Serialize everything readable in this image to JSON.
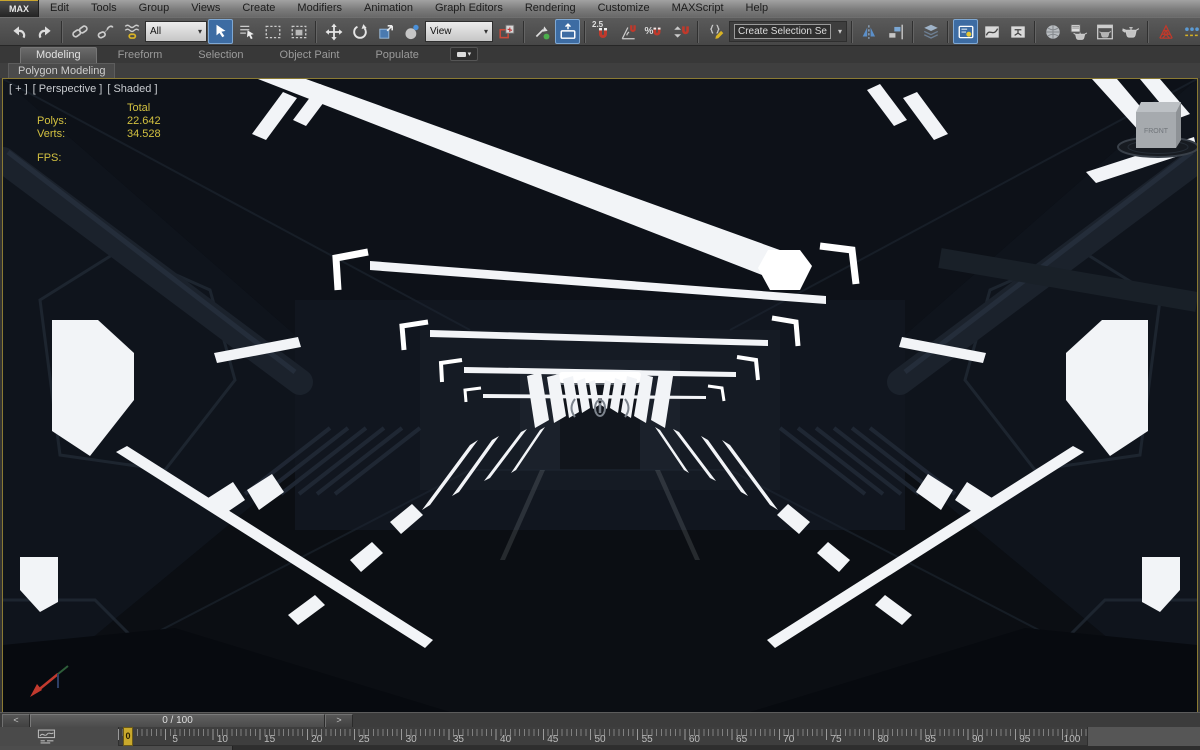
{
  "menu": {
    "logo": "MAX",
    "items": [
      "Edit",
      "Tools",
      "Group",
      "Views",
      "Create",
      "Modifiers",
      "Animation",
      "Graph Editors",
      "Rendering",
      "Customize",
      "MAXScript",
      "Help"
    ]
  },
  "toolbar": {
    "selection_filter": "All",
    "coord_system": "View",
    "named_selection_placeholder": "Create Selection Se",
    "snap_label": "2.5",
    "percent_label": "%",
    "icon_names": [
      "undo-icon",
      "redo-icon",
      "select-link-icon",
      "unlink-icon",
      "bind-spacewarp-icon",
      "select-object-icon",
      "select-by-name-icon",
      "rect-selection-icon",
      "window-crossing-icon",
      "move-icon",
      "rotate-icon",
      "scale-icon",
      "select-place-icon",
      "pivot-center-icon",
      "manipulate-icon",
      "keyboard-override-icon",
      "snap-toggle-icon",
      "angle-snap-icon",
      "percent-snap-icon",
      "spinner-snap-icon",
      "named-selection-edit-icon",
      "mirror-icon",
      "align-icon",
      "layer-manager-icon",
      "scene-explorer-icon",
      "curve-editor-icon",
      "schematic-view-icon",
      "material-editor-icon",
      "render-setup-icon",
      "rendered-frame-icon",
      "render-production-icon",
      "a360-render-icon",
      "state-sets-icon",
      "render-gallery-icon"
    ]
  },
  "icons": {
    "caret": "▾"
  },
  "ribbon": {
    "tabs": [
      {
        "label": "Modeling",
        "active": true
      },
      {
        "label": "Freeform",
        "active": false
      },
      {
        "label": "Selection",
        "active": false
      },
      {
        "label": "Object Paint",
        "active": false
      },
      {
        "label": "Populate",
        "active": false
      }
    ],
    "panel": "Polygon Modeling"
  },
  "viewport": {
    "label_plus": "[ + ]",
    "label_view": "[ Perspective ]",
    "label_shading": "[ Shaded ]",
    "stats": {
      "total_label": "Total",
      "polys_label": "Polys:",
      "polys_value": "22.642",
      "verts_label": "Verts:",
      "verts_value": "34.528",
      "fps_label": "FPS:"
    },
    "viewcube_face": "FRONT",
    "colors": {
      "border": "#8a7a33",
      "stats_text": "#d2c040",
      "background": "#0a0d12",
      "light": "#f2f4f7",
      "accent_pressed": "#3d6ca3"
    }
  },
  "timeline": {
    "prev_label": "<",
    "next_label": ">",
    "current_range": "0 / 100",
    "marker_frame": "0",
    "frame_labels": [
      "0",
      "5",
      "10",
      "15",
      "20",
      "25",
      "30",
      "35",
      "40",
      "45",
      "50",
      "55",
      "60",
      "65",
      "70",
      "75",
      "80",
      "85",
      "90",
      "95",
      "100"
    ]
  }
}
